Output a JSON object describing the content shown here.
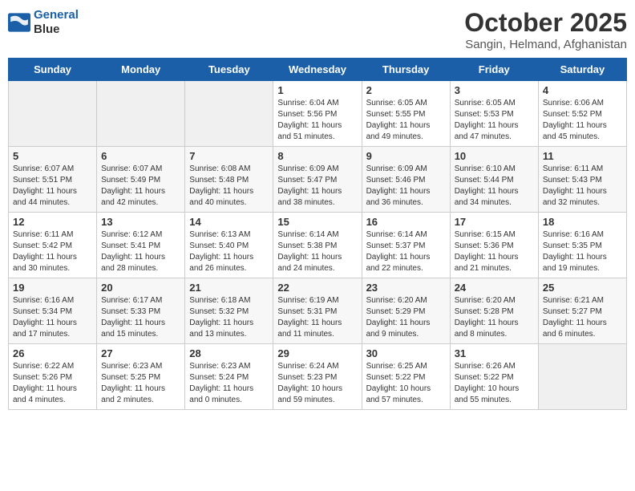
{
  "header": {
    "logo_line1": "General",
    "logo_line2": "Blue",
    "title": "October 2025",
    "subtitle": "Sangin, Helmand, Afghanistan"
  },
  "weekdays": [
    "Sunday",
    "Monday",
    "Tuesday",
    "Wednesday",
    "Thursday",
    "Friday",
    "Saturday"
  ],
  "weeks": [
    [
      {
        "day": "",
        "info": ""
      },
      {
        "day": "",
        "info": ""
      },
      {
        "day": "",
        "info": ""
      },
      {
        "day": "1",
        "info": "Sunrise: 6:04 AM\nSunset: 5:56 PM\nDaylight: 11 hours\nand 51 minutes."
      },
      {
        "day": "2",
        "info": "Sunrise: 6:05 AM\nSunset: 5:55 PM\nDaylight: 11 hours\nand 49 minutes."
      },
      {
        "day": "3",
        "info": "Sunrise: 6:05 AM\nSunset: 5:53 PM\nDaylight: 11 hours\nand 47 minutes."
      },
      {
        "day": "4",
        "info": "Sunrise: 6:06 AM\nSunset: 5:52 PM\nDaylight: 11 hours\nand 45 minutes."
      }
    ],
    [
      {
        "day": "5",
        "info": "Sunrise: 6:07 AM\nSunset: 5:51 PM\nDaylight: 11 hours\nand 44 minutes."
      },
      {
        "day": "6",
        "info": "Sunrise: 6:07 AM\nSunset: 5:49 PM\nDaylight: 11 hours\nand 42 minutes."
      },
      {
        "day": "7",
        "info": "Sunrise: 6:08 AM\nSunset: 5:48 PM\nDaylight: 11 hours\nand 40 minutes."
      },
      {
        "day": "8",
        "info": "Sunrise: 6:09 AM\nSunset: 5:47 PM\nDaylight: 11 hours\nand 38 minutes."
      },
      {
        "day": "9",
        "info": "Sunrise: 6:09 AM\nSunset: 5:46 PM\nDaylight: 11 hours\nand 36 minutes."
      },
      {
        "day": "10",
        "info": "Sunrise: 6:10 AM\nSunset: 5:44 PM\nDaylight: 11 hours\nand 34 minutes."
      },
      {
        "day": "11",
        "info": "Sunrise: 6:11 AM\nSunset: 5:43 PM\nDaylight: 11 hours\nand 32 minutes."
      }
    ],
    [
      {
        "day": "12",
        "info": "Sunrise: 6:11 AM\nSunset: 5:42 PM\nDaylight: 11 hours\nand 30 minutes."
      },
      {
        "day": "13",
        "info": "Sunrise: 6:12 AM\nSunset: 5:41 PM\nDaylight: 11 hours\nand 28 minutes."
      },
      {
        "day": "14",
        "info": "Sunrise: 6:13 AM\nSunset: 5:40 PM\nDaylight: 11 hours\nand 26 minutes."
      },
      {
        "day": "15",
        "info": "Sunrise: 6:14 AM\nSunset: 5:38 PM\nDaylight: 11 hours\nand 24 minutes."
      },
      {
        "day": "16",
        "info": "Sunrise: 6:14 AM\nSunset: 5:37 PM\nDaylight: 11 hours\nand 22 minutes."
      },
      {
        "day": "17",
        "info": "Sunrise: 6:15 AM\nSunset: 5:36 PM\nDaylight: 11 hours\nand 21 minutes."
      },
      {
        "day": "18",
        "info": "Sunrise: 6:16 AM\nSunset: 5:35 PM\nDaylight: 11 hours\nand 19 minutes."
      }
    ],
    [
      {
        "day": "19",
        "info": "Sunrise: 6:16 AM\nSunset: 5:34 PM\nDaylight: 11 hours\nand 17 minutes."
      },
      {
        "day": "20",
        "info": "Sunrise: 6:17 AM\nSunset: 5:33 PM\nDaylight: 11 hours\nand 15 minutes."
      },
      {
        "day": "21",
        "info": "Sunrise: 6:18 AM\nSunset: 5:32 PM\nDaylight: 11 hours\nand 13 minutes."
      },
      {
        "day": "22",
        "info": "Sunrise: 6:19 AM\nSunset: 5:31 PM\nDaylight: 11 hours\nand 11 minutes."
      },
      {
        "day": "23",
        "info": "Sunrise: 6:20 AM\nSunset: 5:29 PM\nDaylight: 11 hours\nand 9 minutes."
      },
      {
        "day": "24",
        "info": "Sunrise: 6:20 AM\nSunset: 5:28 PM\nDaylight: 11 hours\nand 8 minutes."
      },
      {
        "day": "25",
        "info": "Sunrise: 6:21 AM\nSunset: 5:27 PM\nDaylight: 11 hours\nand 6 minutes."
      }
    ],
    [
      {
        "day": "26",
        "info": "Sunrise: 6:22 AM\nSunset: 5:26 PM\nDaylight: 11 hours\nand 4 minutes."
      },
      {
        "day": "27",
        "info": "Sunrise: 6:23 AM\nSunset: 5:25 PM\nDaylight: 11 hours\nand 2 minutes."
      },
      {
        "day": "28",
        "info": "Sunrise: 6:23 AM\nSunset: 5:24 PM\nDaylight: 11 hours\nand 0 minutes."
      },
      {
        "day": "29",
        "info": "Sunrise: 6:24 AM\nSunset: 5:23 PM\nDaylight: 10 hours\nand 59 minutes."
      },
      {
        "day": "30",
        "info": "Sunrise: 6:25 AM\nSunset: 5:22 PM\nDaylight: 10 hours\nand 57 minutes."
      },
      {
        "day": "31",
        "info": "Sunrise: 6:26 AM\nSunset: 5:22 PM\nDaylight: 10 hours\nand 55 minutes."
      },
      {
        "day": "",
        "info": ""
      }
    ]
  ]
}
